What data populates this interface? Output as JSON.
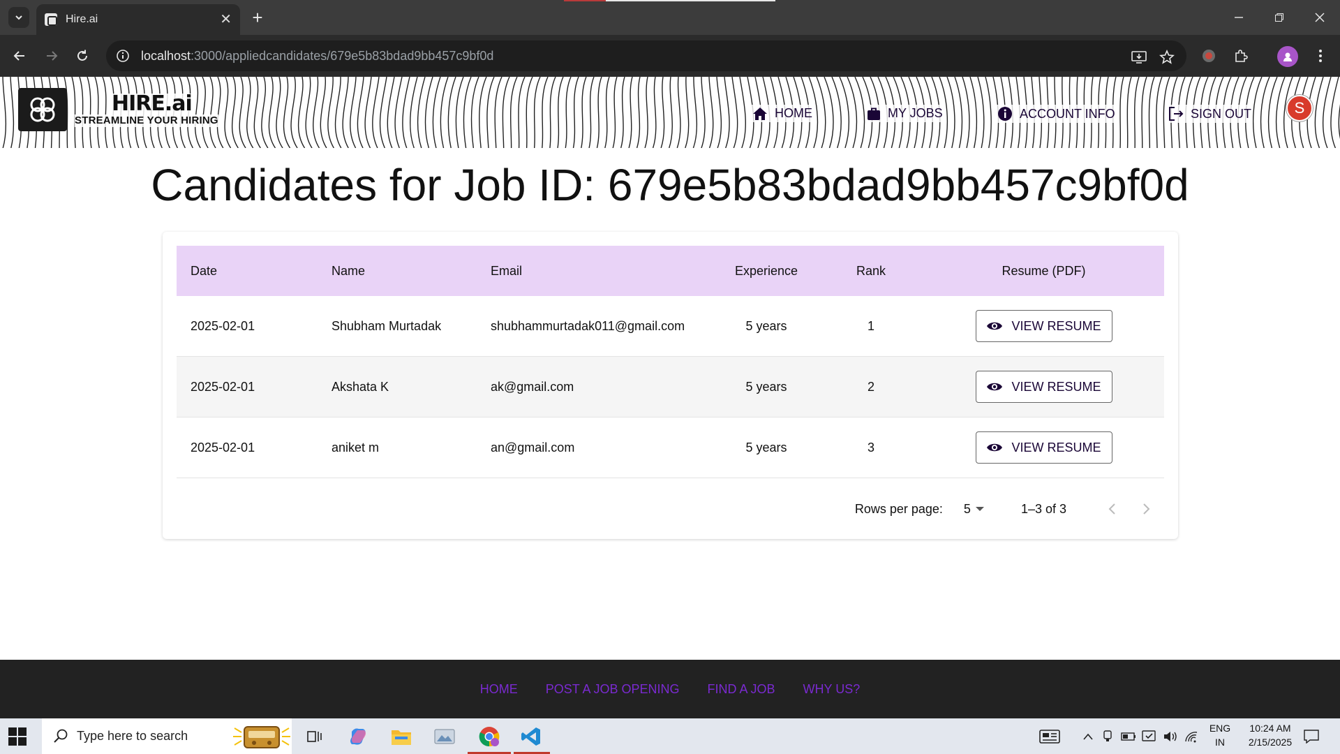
{
  "browser": {
    "tab_title": "Hire.ai",
    "url_host": "localhost",
    "url_path": ":3000/appliedcandidates/679e5b83bdad9bb457c9bf0d"
  },
  "header": {
    "brand_name": "HIRE.ai",
    "brand_tagline": "STREAMLINE YOUR HIRING",
    "nav": [
      {
        "label": "HOME",
        "icon": "home-icon"
      },
      {
        "label": "MY JOBS",
        "icon": "briefcase-icon"
      },
      {
        "label": "ACCOUNT INFO",
        "icon": "info-icon"
      },
      {
        "label": "SIGN OUT",
        "icon": "logout-icon"
      }
    ],
    "avatar_initial": "S",
    "avatar_color": "#d83b2c"
  },
  "main": {
    "title": "Candidates for Job ID: 679e5b83bdad9bb457c9bf0d",
    "columns": [
      "Date",
      "Name",
      "Email",
      "Experience",
      "Rank",
      "Resume (PDF)"
    ],
    "rows": [
      {
        "date": "2025-02-01",
        "name": "Shubham Murtadak",
        "email": "shubhammurtadak011@gmail.com",
        "experience": "5 years",
        "rank": "1",
        "action": "VIEW RESUME"
      },
      {
        "date": "2025-02-01",
        "name": "Akshata K",
        "email": "ak@gmail.com",
        "experience": "5 years",
        "rank": "2",
        "action": "VIEW RESUME"
      },
      {
        "date": "2025-02-01",
        "name": "aniket m",
        "email": "an@gmail.com",
        "experience": "5 years",
        "rank": "3",
        "action": "VIEW RESUME"
      }
    ],
    "pagination": {
      "rows_per_page_label": "Rows per page:",
      "rows_per_page_value": "5",
      "range": "1–3 of 3"
    },
    "header_row_color": "#e9d3f7"
  },
  "footer": {
    "links": [
      "HOME",
      "POST A JOB OPENING",
      "FIND A JOB",
      "WHY US?"
    ],
    "link_color": "#7a2ad0"
  },
  "taskbar": {
    "search_placeholder": "Type here to search",
    "lang_top": "ENG",
    "lang_bottom": "IN",
    "time": "10:24 AM",
    "date": "2/15/2025"
  }
}
